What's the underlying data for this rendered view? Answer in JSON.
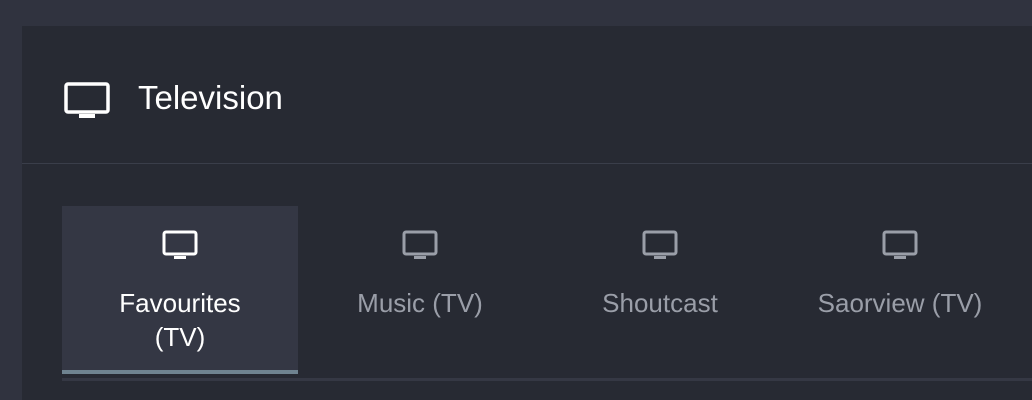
{
  "header": {
    "icon": "tv-icon",
    "title": "Television"
  },
  "tabs": [
    {
      "label": "Favourites (TV)",
      "icon": "tv-icon",
      "active": true
    },
    {
      "label": "Music (TV)",
      "icon": "tv-icon",
      "active": false
    },
    {
      "label": "Shoutcast",
      "icon": "tv-icon",
      "active": false
    },
    {
      "label": "Saorview (TV)",
      "icon": "tv-icon",
      "active": false
    }
  ],
  "colors": {
    "background": "#30333f",
    "panel": "#272a33",
    "active_tab": "#343744",
    "active_indicator": "#6f8390",
    "active_text": "#ffffff",
    "inactive_text": "#9a9ea8"
  }
}
